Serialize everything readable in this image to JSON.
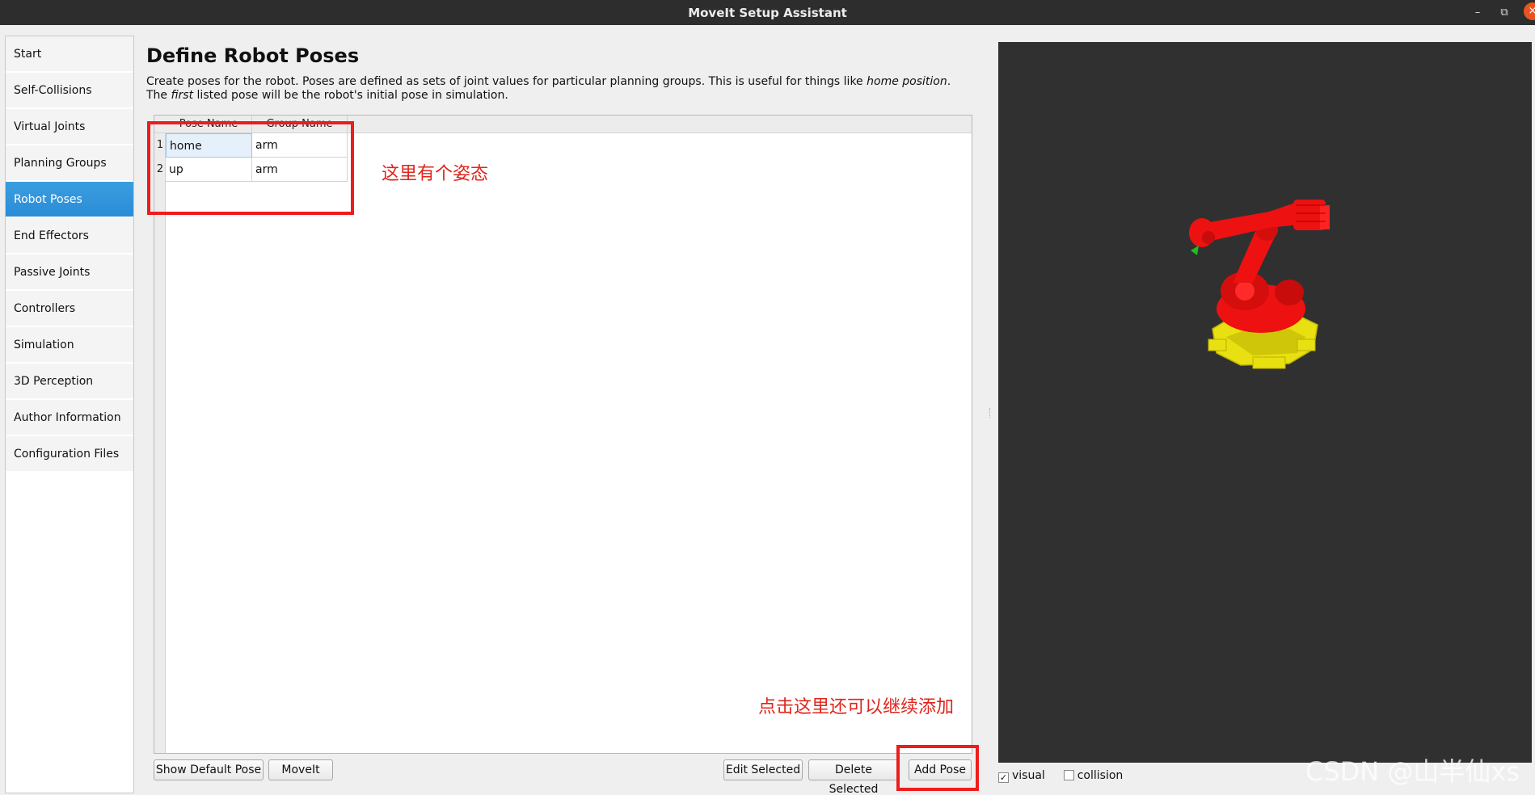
{
  "window": {
    "title": "MoveIt Setup Assistant",
    "min_icon": "minimize-icon",
    "max_icon": "maximize-icon",
    "close_icon": "close-icon"
  },
  "sidebar": {
    "items": [
      {
        "label": "Start"
      },
      {
        "label": "Self-Collisions"
      },
      {
        "label": "Virtual Joints"
      },
      {
        "label": "Planning Groups"
      },
      {
        "label": "Robot Poses",
        "active": true
      },
      {
        "label": "End Effectors"
      },
      {
        "label": "Passive Joints"
      },
      {
        "label": "Controllers"
      },
      {
        "label": "Simulation"
      },
      {
        "label": "3D Perception"
      },
      {
        "label": "Author Information"
      },
      {
        "label": "Configuration Files"
      }
    ]
  },
  "main": {
    "title": "Define Robot Poses",
    "description_part1": "Create poses for the robot. Poses are defined as sets of joint values for particular planning groups. This is useful for things like ",
    "description_italic1": "home position",
    "description_part2": ". The ",
    "description_italic2": "first",
    "description_part3": " listed pose will be the robot's initial pose in simulation.",
    "table": {
      "columns": [
        "Pose Name",
        "Group Name"
      ],
      "rows": [
        {
          "num": "1",
          "pose": "home",
          "group": "arm"
        },
        {
          "num": "2",
          "pose": "up",
          "group": "arm"
        }
      ]
    },
    "buttons": {
      "show_default": "Show Default Pose",
      "moveit": "MoveIt",
      "edit_selected": "Edit Selected",
      "delete_selected": "Delete Selected",
      "add_pose": "Add Pose"
    }
  },
  "annotations": {
    "poses_note": "这里有个姿态",
    "add_note": "点击这里还可以继续添加",
    "color": "#e0241b"
  },
  "viewport": {
    "background": "#303030",
    "robot_color": "#ee1111",
    "base_color": "#e8e010",
    "visual_label": "visual",
    "visual_checked": "✓",
    "collision_label": "collision"
  },
  "watermark": "CSDN @山半仙xs",
  "colors": {
    "active_nav": "#2b8cd6",
    "annotation_red": "#ee1c1c"
  }
}
